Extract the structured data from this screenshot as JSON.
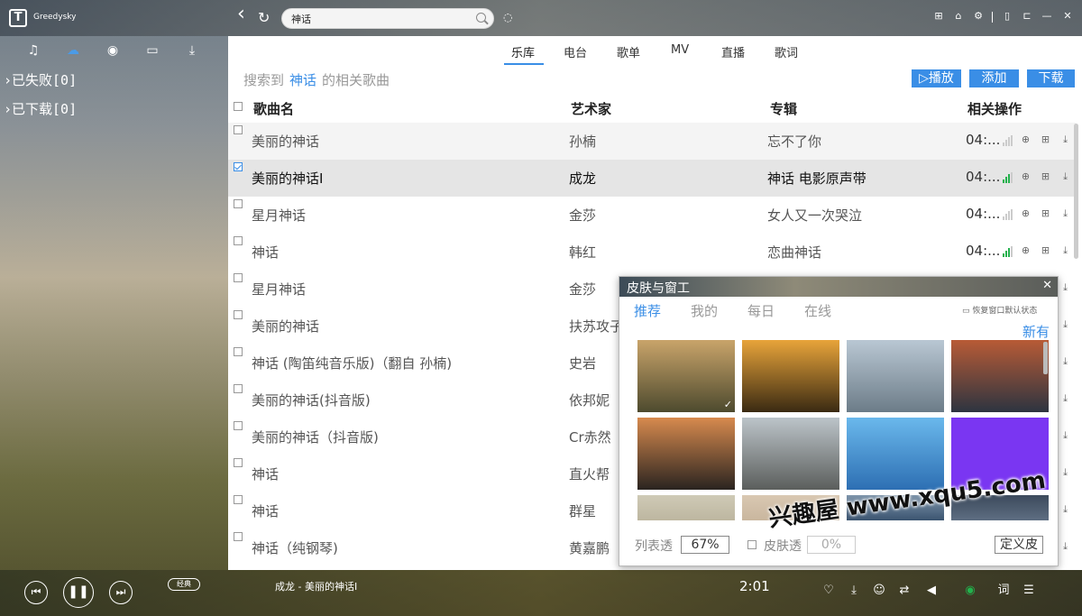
{
  "app": {
    "username": "Greedysky",
    "logo_letter": "T"
  },
  "nav": {
    "back_icon": "‹",
    "refresh_icon": "↻"
  },
  "search": {
    "value": "神话",
    "placeholder": ""
  },
  "sidebar": {
    "tab_icons": [
      "music-note-icon",
      "cloud-icon",
      "radio-icon",
      "device-icon",
      "download-tray-icon"
    ],
    "nodes": [
      "已失败[0]",
      "已下载[0]"
    ]
  },
  "category_tabs": [
    "乐库",
    "电台",
    "歌单",
    "MV",
    "直播",
    "歌词"
  ],
  "hint": {
    "prefix": "搜索到",
    "keyword": "神话",
    "suffix": "的相关歌曲"
  },
  "actions": {
    "play": "▷播放",
    "add": "添加",
    "download": "下载"
  },
  "table": {
    "headers": {
      "name": "歌曲名",
      "artist": "艺术家",
      "album": "专辑",
      "ops": "相关操作"
    },
    "rows": [
      {
        "name": "美丽的神话",
        "artist": "孙楠",
        "album": "忘不了你",
        "duration": "04:...",
        "hq": false,
        "checked": false
      },
      {
        "name": "美丽的神话Ⅰ",
        "artist": "成龙",
        "album": "神话 电影原声带",
        "duration": "04:...",
        "hq": true,
        "checked": true
      },
      {
        "name": "星月神话",
        "artist": "金莎",
        "album": "女人又一次哭泣",
        "duration": "04:...",
        "hq": false,
        "checked": false
      },
      {
        "name": "神话",
        "artist": "韩红",
        "album": "恋曲神话",
        "duration": "04:...",
        "hq": true,
        "checked": false
      },
      {
        "name": "星月神话",
        "artist": "金莎",
        "album": "",
        "duration": "",
        "hq": false,
        "checked": false
      },
      {
        "name": "美丽的神话",
        "artist": "扶苏攻子",
        "album": "",
        "duration": "",
        "hq": false,
        "checked": false
      },
      {
        "name": "神话 (陶笛纯音乐版)（翻自 孙楠)",
        "artist": "史岩",
        "album": "",
        "duration": "",
        "hq": false,
        "checked": false
      },
      {
        "name": "美丽的神话(抖音版)",
        "artist": "依邦妮",
        "album": "",
        "duration": "",
        "hq": false,
        "checked": false
      },
      {
        "name": "美丽的神话（抖音版)",
        "artist": "Cr赤然",
        "album": "",
        "duration": "",
        "hq": false,
        "checked": false
      },
      {
        "name": "神话",
        "artist": "直火帮",
        "album": "",
        "duration": "",
        "hq": false,
        "checked": false
      },
      {
        "name": "神话",
        "artist": "群星",
        "album": "",
        "duration": "",
        "hq": false,
        "checked": false
      },
      {
        "name": "神话（纯钢琴)",
        "artist": "黄嘉鹏",
        "album": "",
        "duration": "",
        "hq": false,
        "checked": false
      }
    ]
  },
  "skin_dialog": {
    "title": "皮肤与窗工",
    "tabs": [
      "推荐",
      "我的",
      "每日",
      "在线"
    ],
    "reset_label": "恢复窗口默认状态",
    "new_label": "新有",
    "list_transparency_label": "列表透",
    "list_transparency_value": "67%",
    "skin_transparency_label": "皮肤透",
    "skin_transparency_value": "0%",
    "custom_label": "定义皮",
    "selected_index": 0,
    "thumb_colors": [
      [
        "#c9a46a",
        "#4d4a2e"
      ],
      [
        "#e8a43a",
        "#3a2a12"
      ],
      [
        "#b9c7d3",
        "#6c7c88"
      ],
      [
        "#b85b36",
        "#2d3440"
      ],
      [
        "#d78a4e",
        "#2a2420"
      ],
      [
        "#bcc4c9",
        "#5b5e5c"
      ],
      [
        "#6ab8ec",
        "#2d6fb3"
      ],
      [
        "#7a36f2",
        "#7a36f2"
      ],
      [
        "#cfcab6",
        "#bdb6a0"
      ],
      [
        "#d9c8b2",
        "#c9b69e"
      ],
      [
        "#7d94aa",
        "#3b5470"
      ],
      [
        "#3c4a5c",
        "#5e6e82"
      ]
    ]
  },
  "player": {
    "now_playing": "成龙 - 美丽的神话Ⅰ",
    "mode": "经典",
    "time": "2:01"
  },
  "watermark": "兴趣屋 www.xqu5.com"
}
